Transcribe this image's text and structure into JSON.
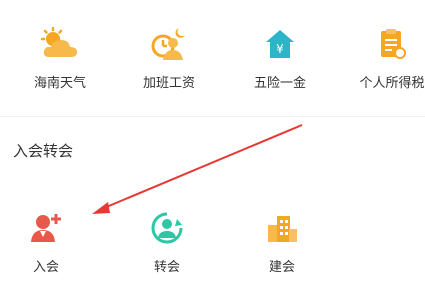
{
  "top_services": [
    {
      "label": "海南天气",
      "icon": "weather-icon"
    },
    {
      "label": "加班工资",
      "icon": "overtime-pay-icon"
    },
    {
      "label": "五险一金",
      "icon": "insurance-house-icon"
    },
    {
      "label": "个人所得税",
      "icon": "tax-document-icon"
    }
  ],
  "section": {
    "title": "入会转会",
    "items": [
      {
        "label": "入会",
        "icon": "join-member-icon"
      },
      {
        "label": "转会",
        "icon": "transfer-member-icon"
      },
      {
        "label": "建会",
        "icon": "build-union-icon"
      }
    ]
  },
  "annotation": {
    "color": "#e53935",
    "points_to": "入会"
  },
  "colors": {
    "orange": "#f5a623",
    "teal": "#2cc7a4",
    "red": "#e8584b",
    "text": "#333333"
  }
}
